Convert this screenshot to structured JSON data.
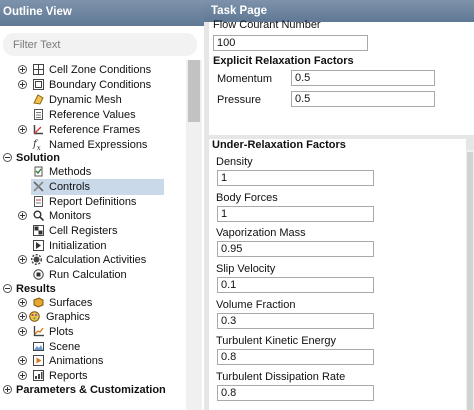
{
  "outline": {
    "title": "Outline View",
    "filter_placeholder": "Filter Text",
    "items": [
      {
        "label": "Cell Zone Conditions",
        "icon": "cell-zone-icon"
      },
      {
        "label": "Boundary Conditions",
        "icon": "boundary-icon"
      },
      {
        "label": "Dynamic Mesh",
        "icon": "dynamic-mesh-icon"
      },
      {
        "label": "Reference Values",
        "icon": "reference-values-icon"
      },
      {
        "label": "Reference Frames",
        "icon": "reference-frames-icon"
      },
      {
        "label": "Named Expressions",
        "icon": "named-expressions-icon"
      },
      {
        "label": "Solution"
      },
      {
        "label": "Methods",
        "icon": "methods-icon"
      },
      {
        "label": "Controls",
        "icon": "controls-icon"
      },
      {
        "label": "Report Definitions",
        "icon": "report-definitions-icon"
      },
      {
        "label": "Monitors",
        "icon": "monitors-icon"
      },
      {
        "label": "Cell Registers",
        "icon": "cell-registers-icon"
      },
      {
        "label": "Initialization",
        "icon": "initialization-icon"
      },
      {
        "label": "Calculation Activities",
        "icon": "calculation-activities-icon"
      },
      {
        "label": "Run Calculation",
        "icon": "run-calculation-icon"
      },
      {
        "label": "Results"
      },
      {
        "label": "Surfaces",
        "icon": "surfaces-icon"
      },
      {
        "label": "Graphics",
        "icon": "graphics-icon"
      },
      {
        "label": "Plots",
        "icon": "plots-icon"
      },
      {
        "label": "Scene",
        "icon": "scene-icon"
      },
      {
        "label": "Animations",
        "icon": "animations-icon"
      },
      {
        "label": "Reports",
        "icon": "reports-icon"
      },
      {
        "label": "Parameters & Customization"
      }
    ]
  },
  "task": {
    "title": "Task Page",
    "flow_courant_label": "Flow Courant Number",
    "flow_courant_value": "100",
    "explicit": {
      "title": "Explicit Relaxation Factors",
      "momentum_label": "Momentum",
      "momentum_value": "0.5",
      "pressure_label": "Pressure",
      "pressure_value": "0.5"
    },
    "under_relaxation": {
      "title": "Under-Relaxation Factors",
      "fields": [
        {
          "label": "Density",
          "value": "1"
        },
        {
          "label": "Body Forces",
          "value": "1"
        },
        {
          "label": "Vaporization Mass",
          "value": "0.95"
        },
        {
          "label": "Slip Velocity",
          "value": "0.1"
        },
        {
          "label": "Volume Fraction",
          "value": "0.3"
        },
        {
          "label": "Turbulent Kinetic Energy",
          "value": "0.8"
        },
        {
          "label": "Turbulent Dissipation Rate",
          "value": "0.8"
        }
      ]
    }
  },
  "colors": {
    "header": "#6c84a0",
    "selection": "#cad9ea",
    "panel_bg": "#e6e6e6"
  }
}
